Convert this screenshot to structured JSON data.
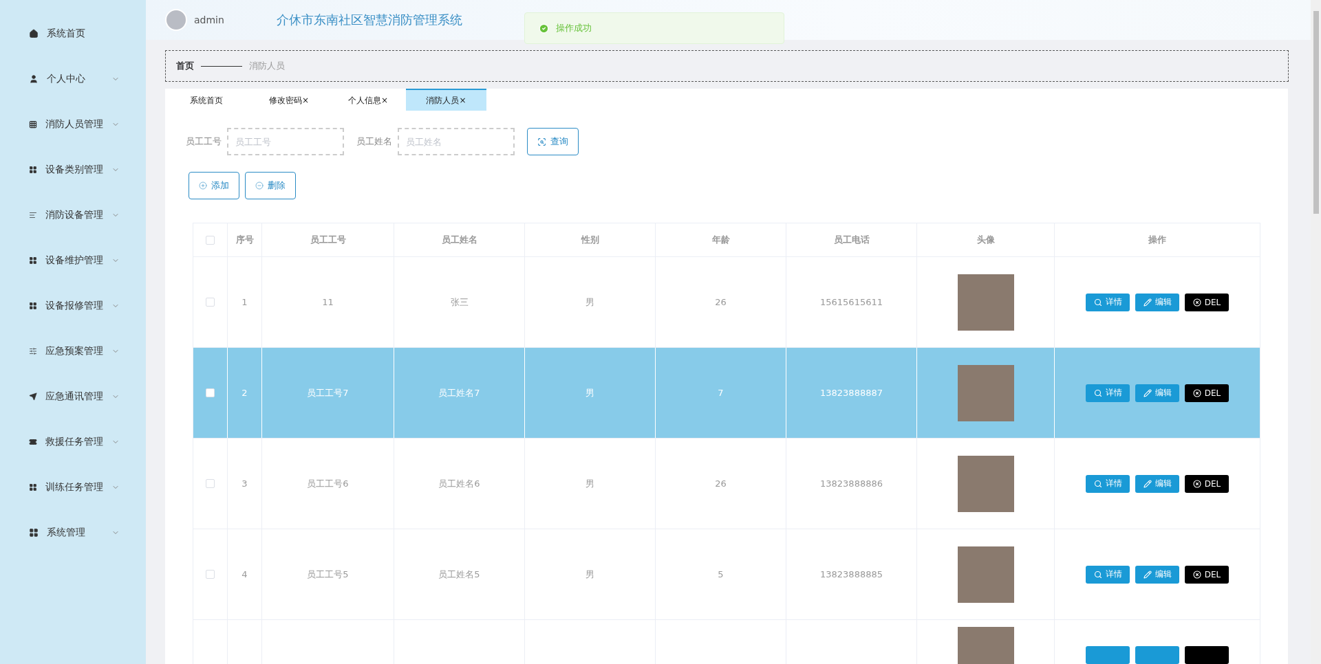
{
  "sidebar": {
    "items": [
      {
        "label": "系统首页",
        "expandable": false
      },
      {
        "label": "个人中心",
        "expandable": true
      },
      {
        "label": "消防人员管理",
        "expandable": true
      },
      {
        "label": "设备类别管理",
        "expandable": true
      },
      {
        "label": "消防设备管理",
        "expandable": true
      },
      {
        "label": "设备维护管理",
        "expandable": true
      },
      {
        "label": "设备报修管理",
        "expandable": true
      },
      {
        "label": "应急预案管理",
        "expandable": true
      },
      {
        "label": "应急通讯管理",
        "expandable": true
      },
      {
        "label": "救援任务管理",
        "expandable": true
      },
      {
        "label": "训练任务管理",
        "expandable": true
      },
      {
        "label": "系统管理",
        "expandable": true
      }
    ]
  },
  "header": {
    "user": "admin",
    "title": "介休市东南社区智慧消防管理系统"
  },
  "toast": {
    "kind": "success",
    "message": "操作成功"
  },
  "breadcrumb": {
    "home": "首页",
    "current": "消防人员"
  },
  "tabs": [
    {
      "label": "系统首页",
      "selected": false
    },
    {
      "label": "修改密码",
      "close": "×",
      "selected": false
    },
    {
      "label": "个人信息",
      "close": "×",
      "selected": false
    },
    {
      "label": "消防人员",
      "close": "×",
      "selected": true
    }
  ],
  "search": {
    "fields": [
      {
        "label": "员工工号",
        "placeholder": "员工工号"
      },
      {
        "label": "员工姓名",
        "placeholder": "员工姓名"
      }
    ],
    "button": "查询"
  },
  "actions": [
    {
      "kind": "add",
      "label": "添加"
    },
    {
      "kind": "remove",
      "label": "删除"
    }
  ],
  "table": {
    "all_checked": false,
    "columns": [
      "序号",
      "员工工号",
      "员工姓名",
      "性别",
      "年龄",
      "员工电话",
      "头像",
      "操作"
    ],
    "rows": [
      {
        "kind": "full",
        "index": "1",
        "id": "11",
        "name": "张三",
        "gender": "男",
        "age": "26",
        "phone": "15615615611",
        "checked": false,
        "selected": false,
        "buttons": [
          "详情",
          "编辑",
          "DEL"
        ]
      },
      {
        "kind": "full",
        "index": "2",
        "id": "员工工号7",
        "name": "员工姓名7",
        "gender": "男",
        "age": "7",
        "phone": "13823888887",
        "checked": false,
        "selected": true,
        "buttons": [
          "详情",
          "编辑",
          "DEL"
        ]
      },
      {
        "kind": "full",
        "index": "3",
        "id": "员工工号6",
        "name": "员工姓名6",
        "gender": "男",
        "age": "26",
        "phone": "13823888886",
        "checked": false,
        "selected": false,
        "buttons": [
          "详情",
          "编辑",
          "DEL"
        ]
      },
      {
        "kind": "full",
        "index": "4",
        "id": "员工工号5",
        "name": "员工姓名5",
        "gender": "男",
        "age": "5",
        "phone": "13823888885",
        "checked": false,
        "selected": false,
        "buttons": [
          "详情",
          "编辑",
          "DEL"
        ]
      },
      {
        "kind": "partial",
        "selected": false
      }
    ]
  }
}
